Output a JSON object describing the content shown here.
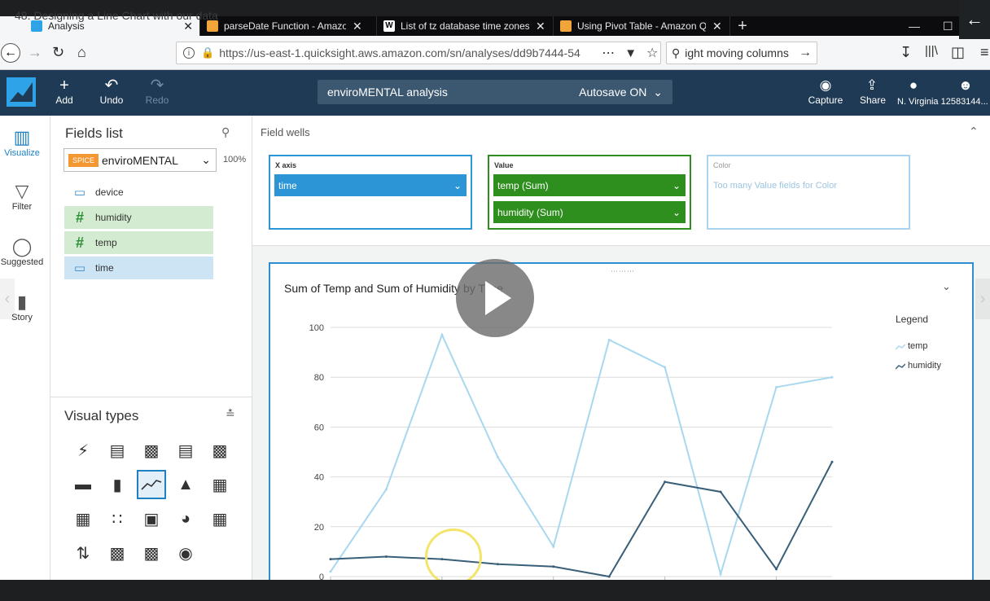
{
  "video": {
    "title": "48. Designing a Line Chart with our data"
  },
  "browser": {
    "tabs": [
      {
        "label": "Analysis",
        "icon_color": "#2ea3e8"
      },
      {
        "label": "parseDate Function - Amazon Q",
        "icon_color": "#f0a53a"
      },
      {
        "label": "List of tz database time zones -",
        "icon_color": "#ffffff"
      },
      {
        "label": "Using Pivot Table - Amazon Qu",
        "icon_color": "#f0a53a"
      }
    ],
    "url": "https://us-east-1.quicksight.aws.amazon.com/sn/analyses/dd9b7444-54",
    "search": "ight moving columns"
  },
  "header": {
    "add": "Add",
    "undo": "Undo",
    "redo": "Redo",
    "analysis_name": "enviroMENTAL analysis",
    "autosave": "Autosave ON",
    "capture": "Capture",
    "share": "Share",
    "region": "N. Virginia 12583144..."
  },
  "rail": {
    "visualize": "Visualize",
    "filter": "Filter",
    "suggested": "Suggested",
    "story": "Story"
  },
  "fields": {
    "title": "Fields list",
    "spice": "SPICE",
    "dataset": "enviroMENTAL",
    "percent": "100%",
    "items": [
      {
        "label": "device",
        "kind": "dimension",
        "selected": false
      },
      {
        "label": "humidity",
        "kind": "measure",
        "selected": true
      },
      {
        "label": "temp",
        "kind": "measure",
        "selected": true
      },
      {
        "label": "time",
        "kind": "dimension",
        "selected": true
      }
    ]
  },
  "visual_types": {
    "title": "Visual types"
  },
  "wells": {
    "title": "Field wells",
    "x_axis": {
      "label": "X axis",
      "fields": [
        "time"
      ],
      "color": "#2b95d6"
    },
    "value": {
      "label": "Value",
      "fields": [
        "temp (Sum)",
        "humidity (Sum)"
      ],
      "color": "#2e8e1e"
    },
    "color": {
      "label": "Color",
      "hint": "Too many Value fields for Color"
    }
  },
  "chart": {
    "title": "Sum of Temp and Sum of Humidity by Time",
    "legend_title": "Legend"
  },
  "chart_data": {
    "type": "line",
    "title": "Sum of Temp and Sum of Humidity by Time",
    "xlabel": "",
    "ylabel": "",
    "ylim": [
      0,
      100
    ],
    "yticks": [
      0,
      20,
      40,
      60,
      80,
      100
    ],
    "grid": true,
    "legend": "right",
    "series": [
      {
        "name": "temp",
        "color": "#a7d8ef",
        "values": [
          2,
          35,
          97,
          48,
          12,
          95,
          84,
          1,
          76,
          80
        ]
      },
      {
        "name": "humidity",
        "color": "#3a5f78",
        "values": [
          7,
          8,
          7,
          5,
          4,
          0,
          38,
          34,
          3,
          46
        ]
      }
    ]
  }
}
